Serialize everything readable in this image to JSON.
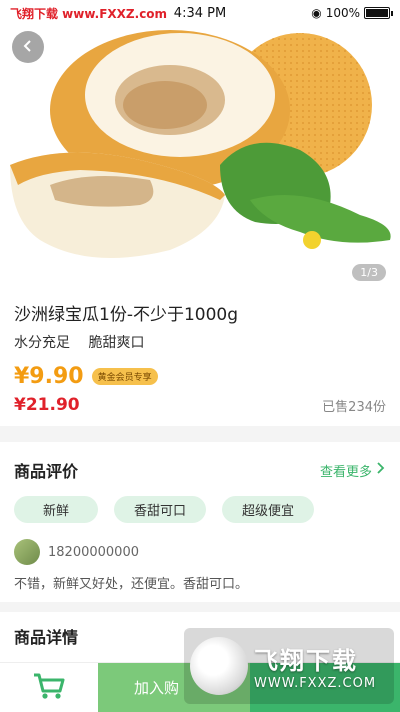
{
  "statusbar": {
    "watermark": "飞翔下载 www.FXXZ.com",
    "time": "4:34 PM",
    "battery": "100%"
  },
  "hero": {
    "counter": "1/3"
  },
  "product": {
    "title": "沙洲绿宝瓜1份-不少于1000g",
    "tags": [
      "水分充足",
      "脆甜爽口"
    ],
    "member_price": "¥9.90",
    "member_badge": "黄金会员专享",
    "price": "¥21.90",
    "sold": "已售234份"
  },
  "review": {
    "title": "商品评价",
    "more": "查看更多",
    "tags": [
      "新鲜",
      "香甜可口",
      "超级便宜"
    ],
    "reviewer": "18200000000",
    "text": "不错，新鲜又好处，还便宜。香甜可口。"
  },
  "detail": {
    "title": "商品详情"
  },
  "bottombar": {
    "add_cart": "加入购",
    "buy": ""
  },
  "watermark": {
    "big": "飞翔下载",
    "small": "WWW.FXXZ.COM"
  },
  "colors": {
    "green": "#3bb56b",
    "light_green": "#7cc97a",
    "orange": "#f39c12",
    "red": "#e0212a"
  }
}
